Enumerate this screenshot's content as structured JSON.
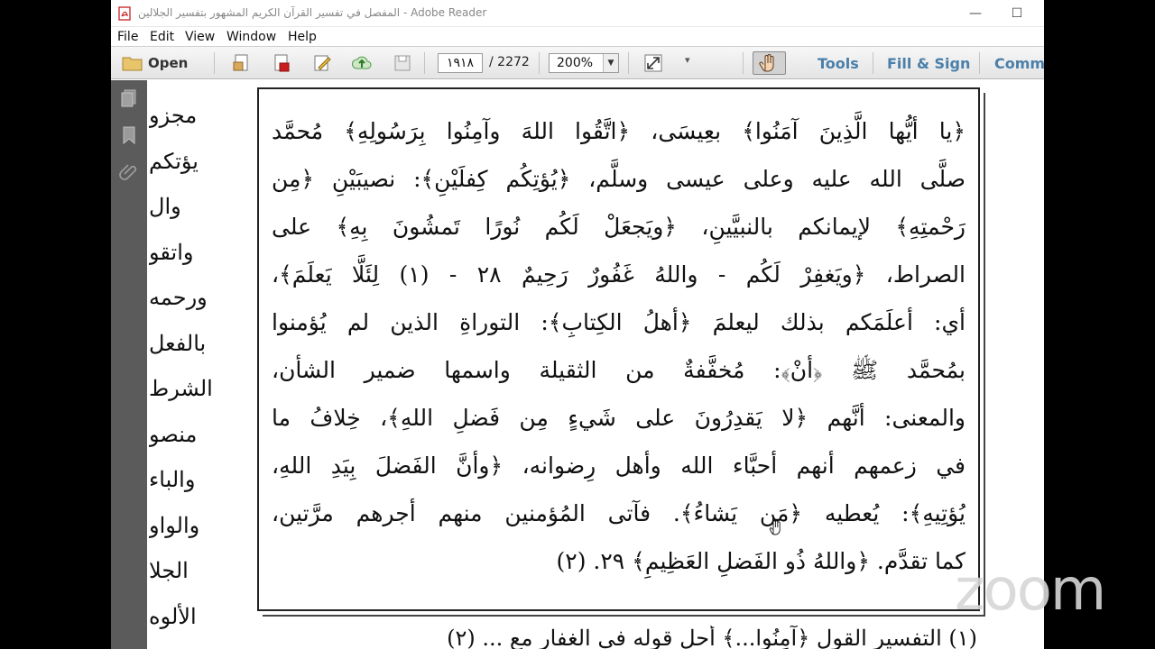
{
  "window": {
    "title": "المفصل في تفسير القرآن الكريم المشهور بتفسير الجلالين - Adobe Reader",
    "minimize_glyph": "—",
    "maximize_glyph": "☐"
  },
  "menu": [
    "File",
    "Edit",
    "View",
    "Window",
    "Help"
  ],
  "toolbar": {
    "open_label": "Open",
    "current_page": "١٩١٨",
    "total_pages": "/  2272",
    "zoom": "200%",
    "tools_label": "Tools",
    "fill_sign_label": "Fill & Sign",
    "comment_label": "Comm"
  },
  "document": {
    "previous_page_column": [
      "مجزو",
      "يؤتكم",
      "وال",
      "واتقو",
      "ورحمه",
      "بالفعل",
      "الشرط",
      "منصو",
      "والباء",
      "والواو",
      "الجلا",
      "الألوه"
    ],
    "lines": [
      "﴿يا أيُّها الَّذِينَ آمَنُوا﴾ بعِيسَى، ﴿اتَّقُوا اللهَ وآمِنُوا بِرَسُولِهِ﴾ مُحمَّد",
      "صلَّى الله عليه وعلى عيسى وسلَّم، ﴿يُؤتِكُم كِفلَيْنِ﴾: نصيبَيْنِ ﴿مِن",
      "رَحْمتِهِ﴾ لإيمانكم بالنبيَّينِ، ﴿ويَجعَلْ لَكُم نُورًا تَمشُونَ بِهِ﴾ على",
      "الصراط، ﴿ويَغفِرْ لَكُم - واللهُ غَفُورٌ رَحِيمٌ ٢٨ - (١) لِئَلَّا يَعلَمَ﴾،",
      "أي: أعلَمَكم بذلك ليعلمَ ﴿أهلُ الكِتابِ﴾: التوراةِ الذين لم يُؤمنوا",
      "بمُحمَّد ﷺ ﴿أنْ﴾: مُخفَّفةٌ من الثقيلة واسمها ضمير الشأن،",
      "والمعنى: أنَّهم ﴿لا يَقدِرُونَ على شَيءٍ مِن فَضلِ اللهِ﴾، خِلافُ ما",
      "في زعمهم أنهم أحبَّاء الله وأهل رِضوانه، ﴿وأنَّ الفَضلَ بِيَدِ اللهِ،",
      "يُؤتِيهِ﴾: يُعطيه ﴿مَن يَشاءُ﴾. فآتى المُؤمنين منهم أجرهم مرَّتين،",
      "كما تقدَّم. ﴿واللهُ ذُو الفَضلِ العَظِيمِ﴾ ٢٩. (٢)"
    ],
    "footnote": "(١) التفسير القول ﴿آمِنُوا...﴾ أحل قوله في الغفار مع ... (٢)"
  },
  "watermark": "zoom",
  "colors": {
    "toolbar_link": "#4a7fa9",
    "side_panel": "#5b5b5b",
    "pdf_red": "#c8201f"
  }
}
